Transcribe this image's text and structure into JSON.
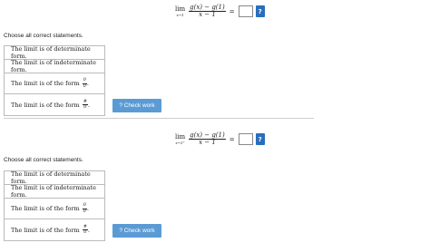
{
  "problems": [
    {
      "lim_word": "lim",
      "lim_sub": "x→1",
      "numerator": "g(x) − g(1)",
      "denominator": "x − 1",
      "equals": "=",
      "help_label": "?",
      "prompt": "Choose all correct statements.",
      "options": [
        "The limit is of determinate form.",
        "The limit is of indeterminate form.",
        "The limit is of the form",
        "The limit is of the form"
      ],
      "option3_frac": {
        "num": "0",
        "den": "0"
      },
      "option4_frac": {
        "num": "#",
        "den": "0"
      },
      "check_label": "? Check work"
    },
    {
      "lim_word": "lim",
      "lim_sub": "x→1⁺",
      "numerator": "g(x) − g(1)",
      "denominator": "x − 1",
      "equals": "=",
      "help_label": "?",
      "prompt": "Choose all correct statements.",
      "options": [
        "The limit is of determinate form.",
        "The limit is of indeterminate form.",
        "The limit is of the form",
        "The limit is of the form"
      ],
      "option3_frac": {
        "num": "0",
        "den": "0"
      },
      "option4_frac": {
        "num": "#",
        "den": "0"
      },
      "check_label": "? Check work"
    }
  ],
  "colors": {
    "help_button": "#2a6ebb",
    "check_button": "#5b9bd5"
  }
}
